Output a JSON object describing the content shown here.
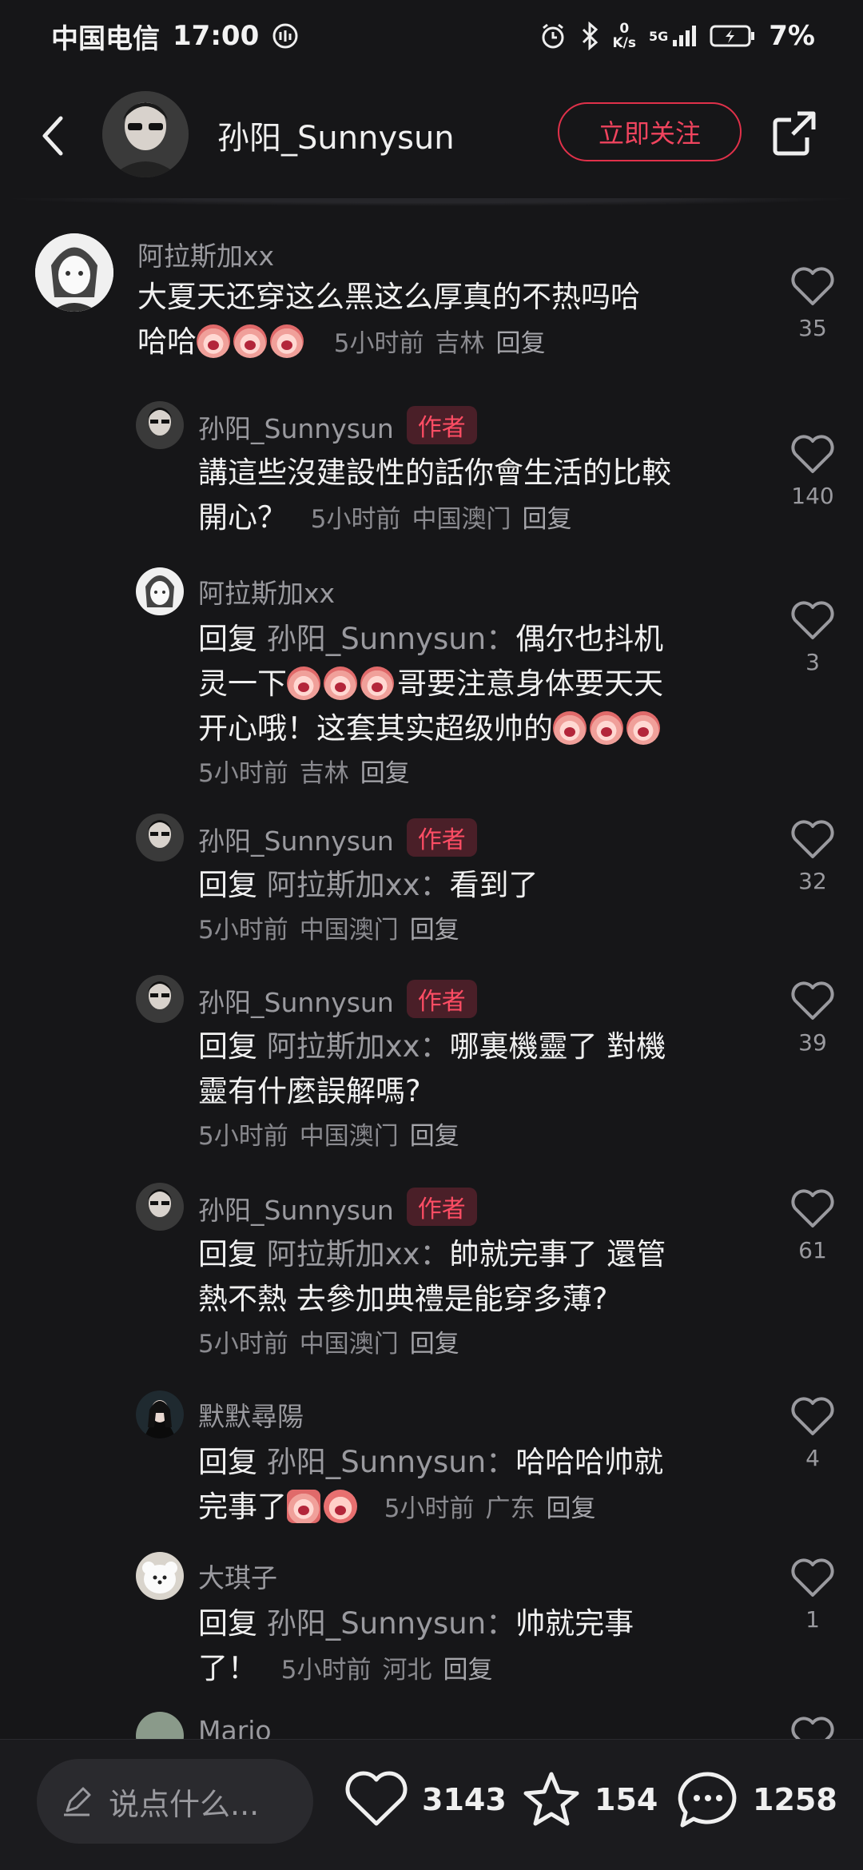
{
  "status_bar": {
    "carrier": "中国电信",
    "time": "17:00",
    "net_speed_value": "0",
    "net_speed_unit": "K/s",
    "signal_label": "5G",
    "battery": "7%"
  },
  "header": {
    "username": "孙阳_Sunnysun",
    "follow_label": "立即关注"
  },
  "comments": [
    {
      "username": "阿拉斯加xx",
      "badge": "",
      "reply_prefix": "",
      "reply_to": "",
      "line1": "大夏天还穿这么黑这么厚真的不热吗哈",
      "line2": "哈哈",
      "time": "5小时前",
      "location": "吉林",
      "reply_label": "回复",
      "likes": "35"
    },
    {
      "username": "孙阳_Sunnysun",
      "badge": "作者",
      "line1": "講這些沒建設性的話你會生活的比較",
      "line2": "開心？",
      "time": "5小时前",
      "location": "中国澳门",
      "reply_label": "回复",
      "likes": "140"
    },
    {
      "username": "阿拉斯加xx",
      "badge": "",
      "reply_prefix": "回复",
      "reply_to": "孙阳_Sunnysun：",
      "line1": "偶尔也抖机",
      "line2a": "灵一下",
      "line2b": "哥要注意身体要天天",
      "line3": "开心哦！这套其实超级帅的",
      "time": "5小时前",
      "location": "吉林",
      "reply_label": "回复",
      "likes": "3"
    },
    {
      "username": "孙阳_Sunnysun",
      "badge": "作者",
      "reply_prefix": "回复",
      "reply_to": "阿拉斯加xx：",
      "line1": "看到了",
      "time": "5小时前",
      "location": "中国澳门",
      "reply_label": "回复",
      "likes": "32"
    },
    {
      "username": "孙阳_Sunnysun",
      "badge": "作者",
      "reply_prefix": "回复",
      "reply_to": "阿拉斯加xx：",
      "line1": "哪裏機靈了 對機",
      "line2": "靈有什麼誤解嗎?",
      "time": "5小时前",
      "location": "中国澳门",
      "reply_label": "回复",
      "likes": "39"
    },
    {
      "username": "孙阳_Sunnysun",
      "badge": "作者",
      "reply_prefix": "回复",
      "reply_to": "阿拉斯加xx：",
      "line1": "帥就完事了 還管",
      "line2": "熱不熱 去參加典禮是能穿多薄?",
      "time": "5小时前",
      "location": "中国澳门",
      "reply_label": "回复",
      "likes": "61"
    },
    {
      "username": "默默尋陽",
      "badge": "",
      "reply_prefix": "回复",
      "reply_to": "孙阳_Sunnysun：",
      "line1": "哈哈哈帅就",
      "line2": "完事了",
      "time": "5小时前",
      "location": "广东",
      "reply_label": "回复",
      "likes": "4"
    },
    {
      "username": "大琪子",
      "badge": "",
      "reply_prefix": "回复",
      "reply_to": "孙阳_Sunnysun：",
      "line1": "帅就完事",
      "line2": "了！",
      "time": "5小时前",
      "location": "河北",
      "reply_label": "回复",
      "likes": "1"
    },
    {
      "username": "Mario"
    }
  ],
  "bottom_bar": {
    "input_placeholder": "说点什么...",
    "likes": "3143",
    "favorites": "154",
    "comments": "1258"
  }
}
